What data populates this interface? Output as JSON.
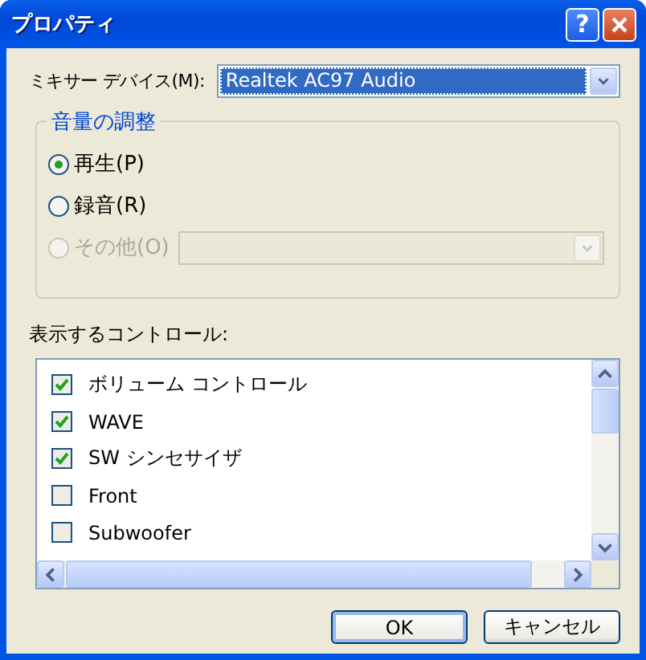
{
  "window": {
    "title": "プロパティ",
    "help_button": "?"
  },
  "mixer_device": {
    "label": "ミキサー デバイス(M):",
    "value": "Realtek AC97 Audio",
    "focused": true
  },
  "volume_group": {
    "title": "音量の調整",
    "options": [
      {
        "kind": "plain",
        "label": "再生(P)",
        "selected": true,
        "disabled": false
      },
      {
        "kind": "plain",
        "label": "録音(R)",
        "selected": false,
        "disabled": false
      },
      {
        "kind": "with_combo",
        "label": "その他(O)",
        "selected": false,
        "disabled": true
      }
    ]
  },
  "controls": {
    "label": "表示するコントロール:",
    "items": [
      {
        "label": "ボリューム コントロール",
        "checked": true
      },
      {
        "label": "WAVE",
        "checked": true
      },
      {
        "label": "SW シンセサイザ",
        "checked": true
      },
      {
        "label": "Front",
        "checked": false
      },
      {
        "label": "Subwoofer",
        "checked": false
      }
    ]
  },
  "buttons": [
    {
      "label": "OK",
      "default": true
    },
    {
      "label": "キャンセル",
      "default": false
    }
  ]
}
